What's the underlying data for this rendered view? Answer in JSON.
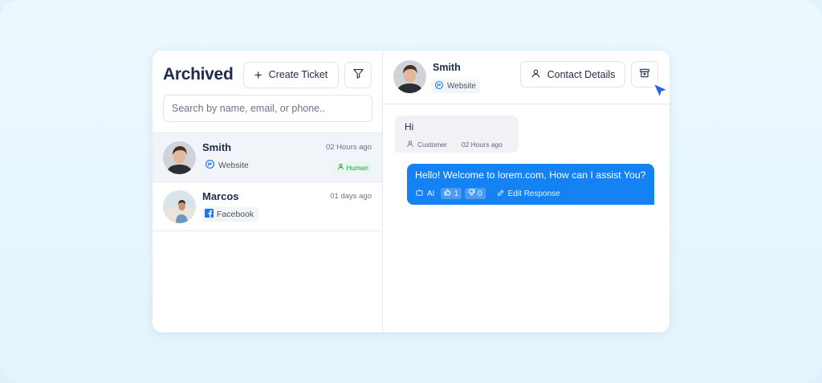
{
  "left_panel": {
    "title": "Archived",
    "create_ticket_label": "Create Ticket",
    "search_placeholder": "Search by name, email, or phone..",
    "conversations": [
      {
        "name": "Smith",
        "time": "02 Hours ago",
        "source": "Website",
        "badge": "Human"
      },
      {
        "name": "Marcos",
        "time": "01 days ago",
        "source": "Facebook"
      }
    ]
  },
  "chat": {
    "contact_name": "Smith",
    "contact_source": "Website",
    "contact_details_label": "Contact Details",
    "messages": [
      {
        "text": "Hi",
        "sender": "Customer",
        "time": "02 Hours ago"
      },
      {
        "text": "Hello! Welcome to lorem.com, How can I assist You?",
        "sender": "AI",
        "likes": "1",
        "dislikes": "0",
        "edit_label": "Edit Response"
      }
    ]
  },
  "icons": [
    "plus-icon",
    "filter-icon",
    "website-icon",
    "facebook-icon",
    "human-icon",
    "person-icon",
    "archive-icon",
    "cursor-icon",
    "bot-icon",
    "thumbs-up-icon",
    "thumbs-down-icon",
    "pencil-icon"
  ],
  "colors": {
    "accent": "#1582f4",
    "text": "#1e2b4a",
    "human_badge": "#1f9d55",
    "facebook": "#1877f2"
  }
}
